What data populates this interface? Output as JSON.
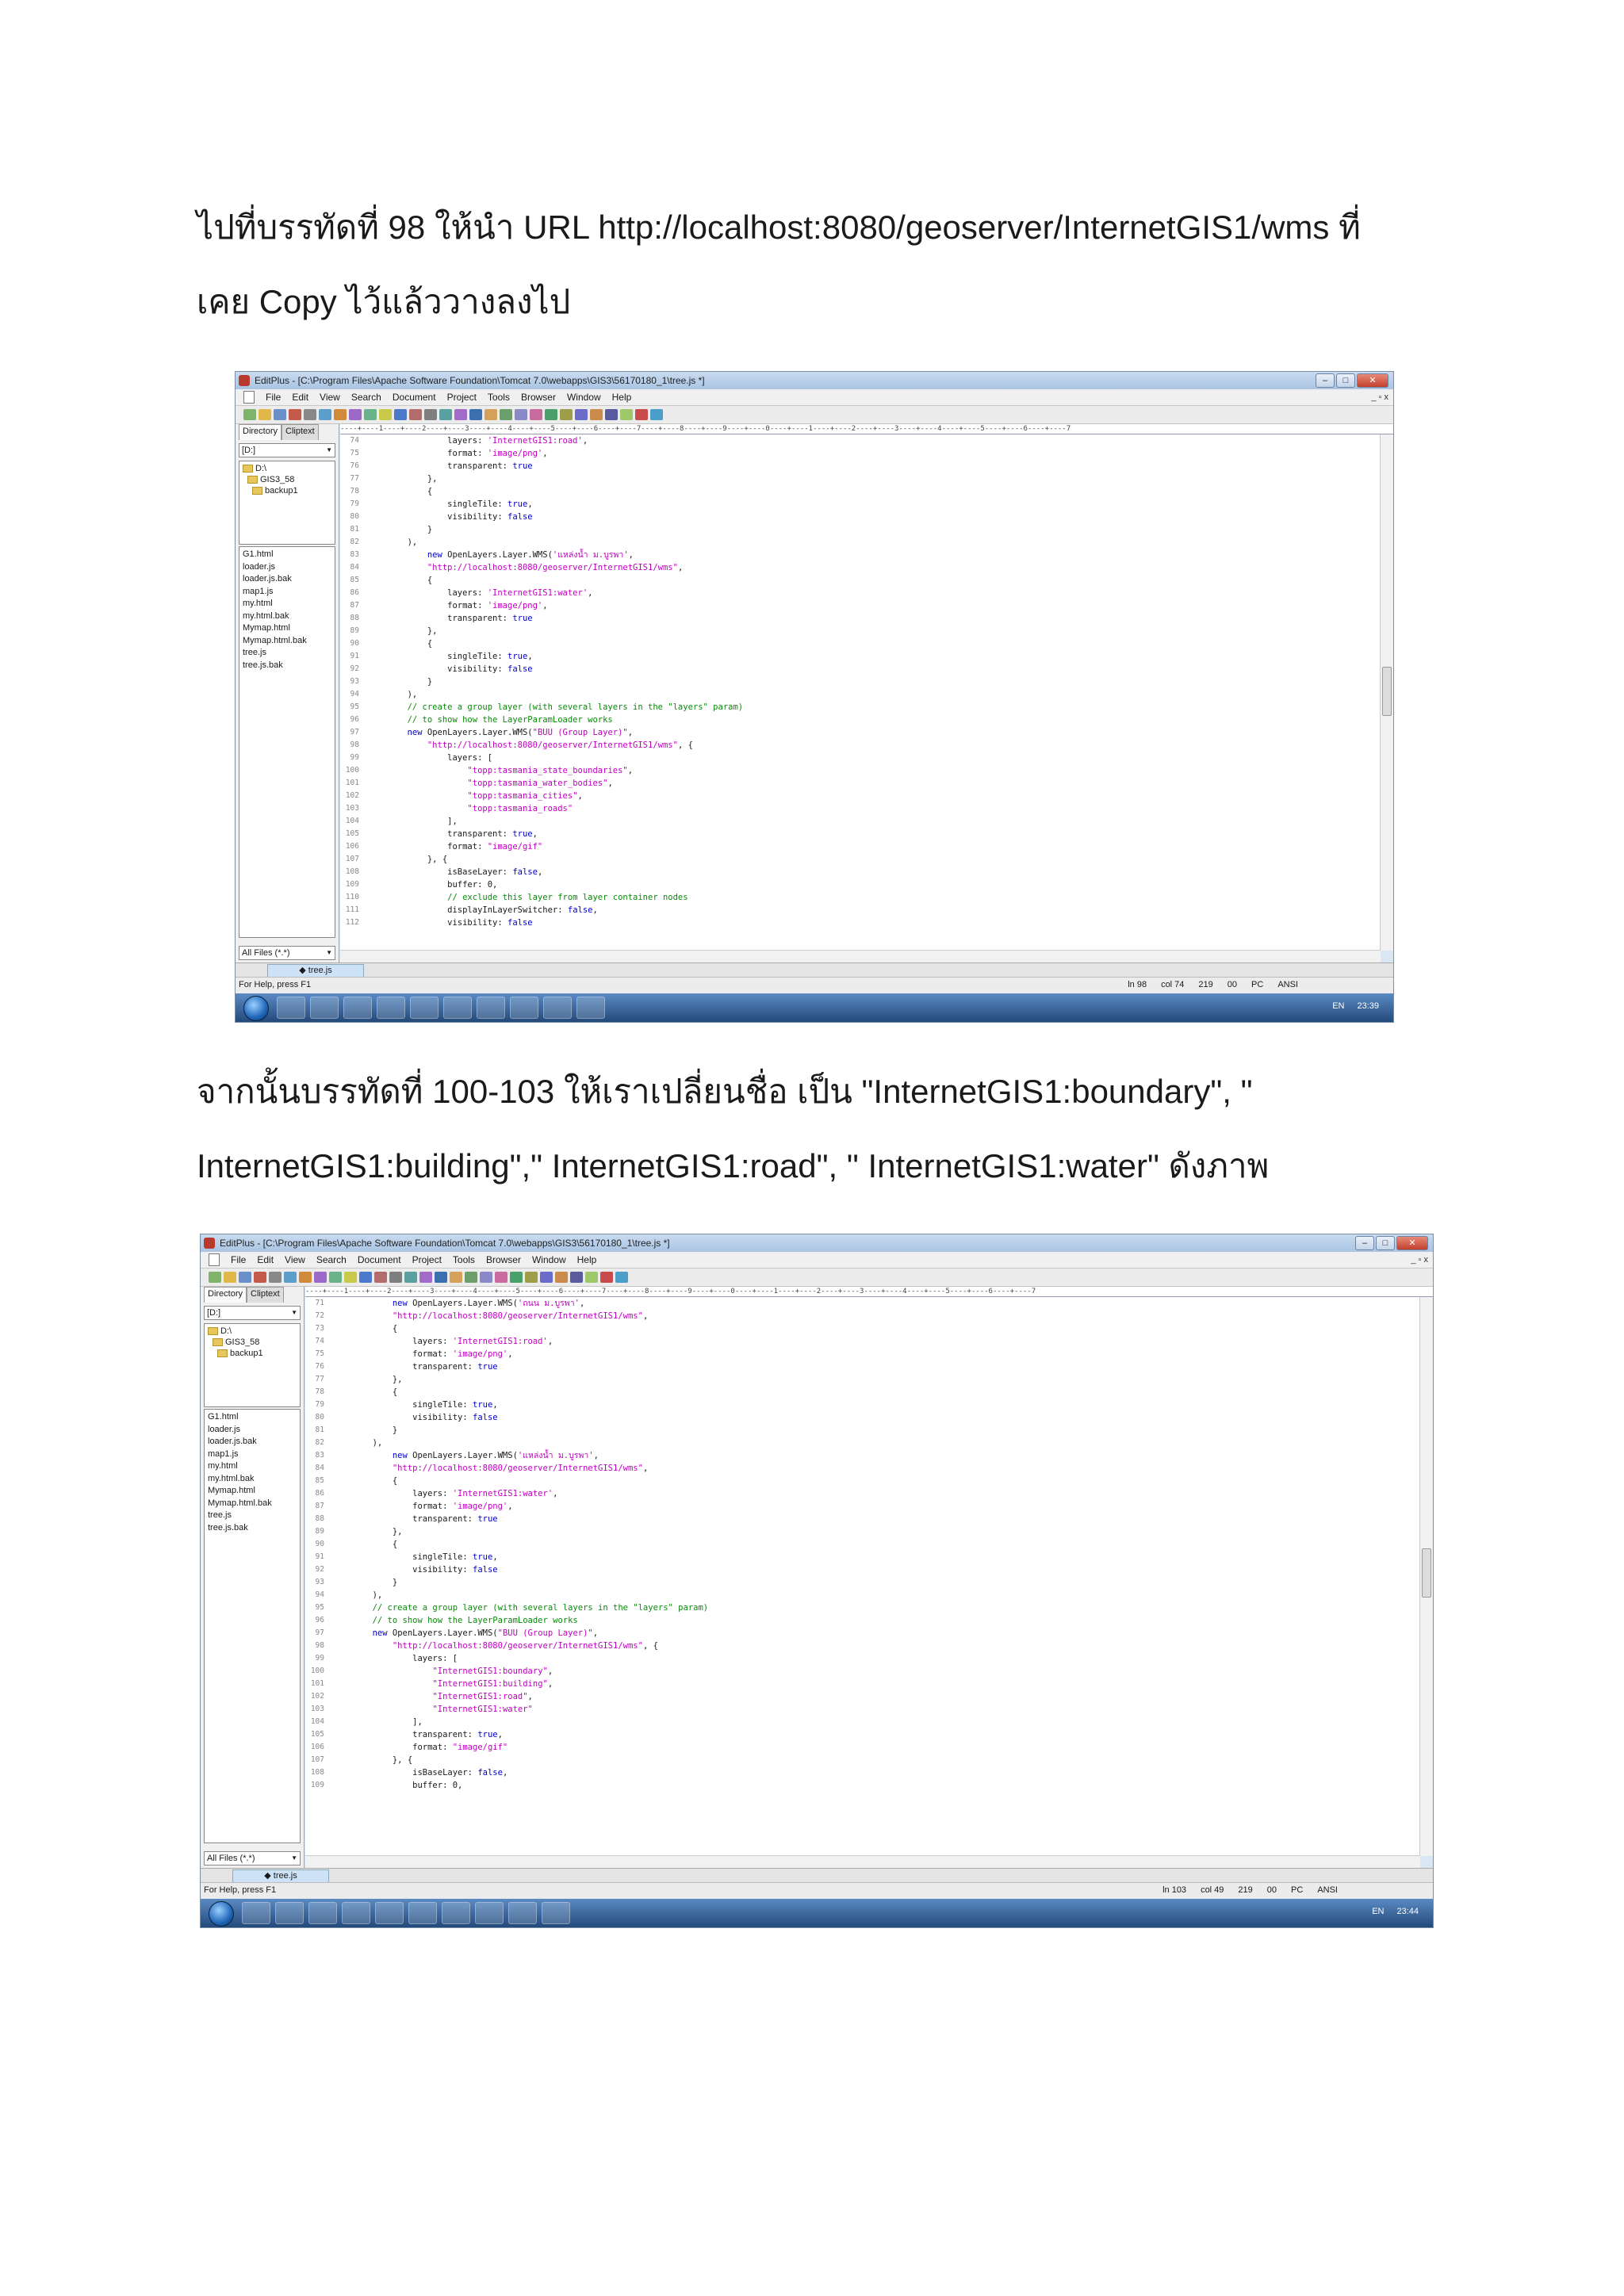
{
  "para1": {
    "line1_text": "ไปที่บรรทัดที่ 98 ให้นำ URL http://localhost:8080/geoserver/InternetGIS1/wms",
    "line1_end": "ที่",
    "line2": "เคย Copy ไว้แล้ววางลงไป"
  },
  "para2": {
    "line1": "จากนั้นบรรทัดที่ 100-103 ให้เราเปลี่ยนชื่อ เป็น \"InternetGIS1:boundary\", \"",
    "line2": "InternetGIS1:building\",\" InternetGIS1:road\", \" InternetGIS1:water\" ดังภาพ"
  },
  "shot1": {
    "title": "EditPlus - [C:\\Program Files\\Apache Software Foundation\\Tomcat 7.0\\webapps\\GIS3\\56170180_1\\tree.js *]",
    "menu": [
      "File",
      "Edit",
      "View",
      "Search",
      "Document",
      "Project",
      "Tools",
      "Browser",
      "Window",
      "Help"
    ],
    "mdi": "_ ▫ x",
    "tabs": [
      "Directory",
      "Cliptext"
    ],
    "drive": "[D:]",
    "tree": [
      "D:\\",
      "GIS3_58",
      "backup1"
    ],
    "files": [
      "G1.html",
      "loader.js",
      "loader.js.bak",
      "map1.js",
      "my.html",
      "my.html.bak",
      "Mymap.html",
      "Mymap.html.bak",
      "tree.js",
      "tree.js.bak"
    ],
    "filter": "All Files (*.*)",
    "doctab": "tree.js",
    "status_left": "For Help, press F1",
    "status": [
      "ln 98",
      "col 74",
      "219",
      "00",
      "PC",
      "ANSI"
    ],
    "tray": [
      "EN",
      "23:39"
    ],
    "ruler": "----+----1----+----2----+----3----+----4----+----5----+----6----+----7----+----8----+----9----+----0----+----1----+----2----+----3----+----4----+----5----+----6----+----7",
    "cursor_line": 98,
    "code": [
      {
        "n": "74",
        "t": "                layers: 'InternetGIS1:road',"
      },
      {
        "n": "75",
        "t": "                format: 'image/png',"
      },
      {
        "n": "76",
        "t": "                transparent: true"
      },
      {
        "n": "77",
        "t": "            },"
      },
      {
        "n": "78",
        "t": "            {"
      },
      {
        "n": "79",
        "t": "                singleTile: true,"
      },
      {
        "n": "80",
        "t": "                visibility: false"
      },
      {
        "n": "81",
        "t": "            }"
      },
      {
        "n": "82",
        "t": "        ),"
      },
      {
        "n": "83",
        "t": "            new OpenLayers.Layer.WMS('แหล่งน้ำ ม.บูรพา',"
      },
      {
        "n": "84",
        "t": "            \"http://localhost:8080/geoserver/InternetGIS1/wms\","
      },
      {
        "n": "85",
        "t": "            {"
      },
      {
        "n": "86",
        "t": "                layers: 'InternetGIS1:water',"
      },
      {
        "n": "87",
        "t": "                format: 'image/png',"
      },
      {
        "n": "88",
        "t": "                transparent: true"
      },
      {
        "n": "89",
        "t": "            },"
      },
      {
        "n": "90",
        "t": "            {"
      },
      {
        "n": "91",
        "t": "                singleTile: true,"
      },
      {
        "n": "92",
        "t": "                visibility: false"
      },
      {
        "n": "93",
        "t": "            }"
      },
      {
        "n": "94",
        "t": "        ),"
      },
      {
        "n": "95",
        "t": "        // create a group layer (with several layers in the \"layers\" param)"
      },
      {
        "n": "96",
        "t": "        // to show how the LayerParamLoader works"
      },
      {
        "n": "97",
        "t": "        new OpenLayers.Layer.WMS(\"BUU (Group Layer)\","
      },
      {
        "n": "98",
        "t": "            \"http://localhost:8080/geoserver/InternetGIS1/wms\", {"
      },
      {
        "n": "99",
        "t": "                layers: ["
      },
      {
        "n": "100",
        "t": "                    \"topp:tasmania_state_boundaries\","
      },
      {
        "n": "101",
        "t": "                    \"topp:tasmania_water_bodies\","
      },
      {
        "n": "102",
        "t": "                    \"topp:tasmania_cities\","
      },
      {
        "n": "103",
        "t": "                    \"topp:tasmania_roads\""
      },
      {
        "n": "104",
        "t": "                ],"
      },
      {
        "n": "105",
        "t": "                transparent: true,"
      },
      {
        "n": "106",
        "t": "                format: \"image/gif\""
      },
      {
        "n": "107",
        "t": "            }, {"
      },
      {
        "n": "108",
        "t": "                isBaseLayer: false,"
      },
      {
        "n": "109",
        "t": "                buffer: 0,"
      },
      {
        "n": "110",
        "t": "                // exclude this layer from layer container nodes"
      },
      {
        "n": "111",
        "t": "                displayInLayerSwitcher: false,"
      },
      {
        "n": "112",
        "t": "                visibility: false"
      }
    ]
  },
  "shot2": {
    "title": "EditPlus - [C:\\Program Files\\Apache Software Foundation\\Tomcat 7.0\\webapps\\GIS3\\56170180_1\\tree.js *]",
    "menu": [
      "File",
      "Edit",
      "View",
      "Search",
      "Document",
      "Project",
      "Tools",
      "Browser",
      "Window",
      "Help"
    ],
    "mdi": "_ ▫ x",
    "tabs": [
      "Directory",
      "Cliptext"
    ],
    "drive": "[D:]",
    "tree": [
      "D:\\",
      "GIS3_58",
      "backup1"
    ],
    "files": [
      "G1.html",
      "loader.js",
      "loader.js.bak",
      "map1.js",
      "my.html",
      "my.html.bak",
      "Mymap.html",
      "Mymap.html.bak",
      "tree.js",
      "tree.js.bak"
    ],
    "filter": "All Files (*.*)",
    "doctab": "tree.js",
    "status_left": "For Help, press F1",
    "status": [
      "ln 103",
      "col 49",
      "219",
      "00",
      "PC",
      "ANSI"
    ],
    "tray": [
      "EN",
      "23:44"
    ],
    "ruler": "----+----1----+----2----+----3----+----4----+----5----+----6----+----7----+----8----+----9----+----0----+----1----+----2----+----3----+----4----+----5----+----6----+----7",
    "cursor_line": 103,
    "code": [
      {
        "n": "71",
        "t": "            new OpenLayers.Layer.WMS('ถนน ม.บูรพา',"
      },
      {
        "n": "72",
        "t": "            \"http://localhost:8080/geoserver/InternetGIS1/wms\","
      },
      {
        "n": "73",
        "t": "            {"
      },
      {
        "n": "74",
        "t": "                layers: 'InternetGIS1:road',"
      },
      {
        "n": "75",
        "t": "                format: 'image/png',"
      },
      {
        "n": "76",
        "t": "                transparent: true"
      },
      {
        "n": "77",
        "t": "            },"
      },
      {
        "n": "78",
        "t": "            {"
      },
      {
        "n": "79",
        "t": "                singleTile: true,"
      },
      {
        "n": "80",
        "t": "                visibility: false"
      },
      {
        "n": "81",
        "t": "            }"
      },
      {
        "n": "82",
        "t": "        ),"
      },
      {
        "n": "83",
        "t": "            new OpenLayers.Layer.WMS('แหล่งน้ำ ม.บูรพา',"
      },
      {
        "n": "84",
        "t": "            \"http://localhost:8080/geoserver/InternetGIS1/wms\","
      },
      {
        "n": "85",
        "t": "            {"
      },
      {
        "n": "86",
        "t": "                layers: 'InternetGIS1:water',"
      },
      {
        "n": "87",
        "t": "                format: 'image/png',"
      },
      {
        "n": "88",
        "t": "                transparent: true"
      },
      {
        "n": "89",
        "t": "            },"
      },
      {
        "n": "90",
        "t": "            {"
      },
      {
        "n": "91",
        "t": "                singleTile: true,"
      },
      {
        "n": "92",
        "t": "                visibility: false"
      },
      {
        "n": "93",
        "t": "            }"
      },
      {
        "n": "94",
        "t": "        ),"
      },
      {
        "n": "95",
        "t": "        // create a group layer (with several layers in the \"layers\" param)"
      },
      {
        "n": "96",
        "t": "        // to show how the LayerParamLoader works"
      },
      {
        "n": "97",
        "t": "        new OpenLayers.Layer.WMS(\"BUU (Group Layer)\","
      },
      {
        "n": "98",
        "t": "            \"http://localhost:8080/geoserver/InternetGIS1/wms\", {"
      },
      {
        "n": "99",
        "t": "                layers: ["
      },
      {
        "n": "100",
        "t": "                    \"InternetGIS1:boundary\","
      },
      {
        "n": "101",
        "t": "                    \"InternetGIS1:building\","
      },
      {
        "n": "102",
        "t": "                    \"InternetGIS1:road\","
      },
      {
        "n": "103",
        "t": "                    \"InternetGIS1:water\""
      },
      {
        "n": "104",
        "t": "                ],"
      },
      {
        "n": "105",
        "t": "                transparent: true,"
      },
      {
        "n": "106",
        "t": "                format: \"image/gif\""
      },
      {
        "n": "107",
        "t": "            }, {"
      },
      {
        "n": "108",
        "t": "                isBaseLayer: false,"
      },
      {
        "n": "109",
        "t": "                buffer: 0,"
      }
    ]
  },
  "colors": {
    "string": "#c000c0",
    "keyword": "#0000cc",
    "comment": "#0a8a0a",
    "taskbar": "#23497a"
  }
}
